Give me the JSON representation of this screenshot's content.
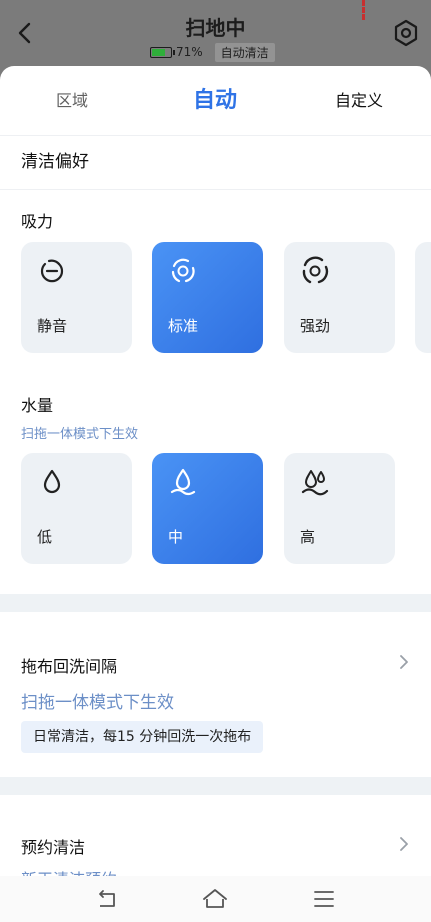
{
  "header": {
    "title": "扫地中",
    "battery_percent": "71%",
    "battery_level": 0.71,
    "mode_chip": "自动清洁"
  },
  "tabs": [
    {
      "label": "区域"
    },
    {
      "label": "自动",
      "selected": true
    },
    {
      "label": "自定义"
    }
  ],
  "preferences": {
    "title": "清洁偏好",
    "suction": {
      "label": "吸力",
      "options": [
        {
          "label": "静音",
          "icon": "quiet-icon"
        },
        {
          "label": "标准",
          "icon": "standard-fan-icon",
          "selected": true
        },
        {
          "label": "强劲",
          "icon": "strong-fan-icon"
        }
      ]
    },
    "water": {
      "label": "水量",
      "note": "扫拖一体模式下生效",
      "options": [
        {
          "label": "低",
          "icon": "water-drop-low-icon"
        },
        {
          "label": "中",
          "icon": "water-drop-medium-icon",
          "selected": true
        },
        {
          "label": "高",
          "icon": "water-drop-high-icon"
        }
      ]
    }
  },
  "mop_wash": {
    "title": "拖布回洗间隔",
    "note": "扫拖一体模式下生效",
    "desc": "日常清洁，每15 分钟回洗一次拖布"
  },
  "schedule": {
    "title": "预约清洁",
    "partial_text": "新王清洁预约"
  },
  "colors": {
    "accent": "#2f73e6",
    "card_bg": "#edf1f5",
    "note_blue": "#6c8fc7"
  }
}
